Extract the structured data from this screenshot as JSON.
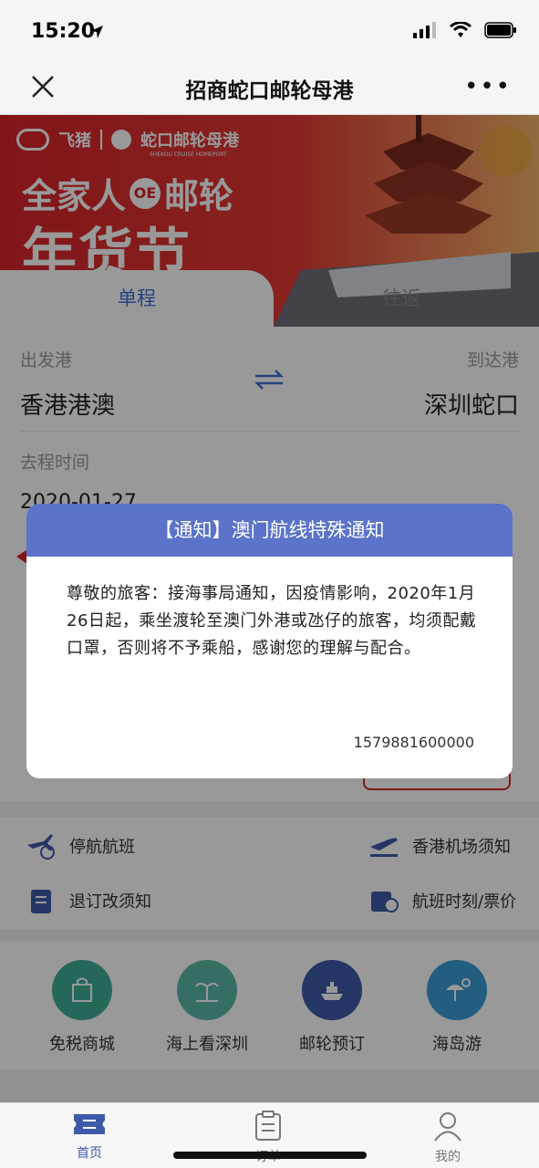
{
  "status": {
    "time": "15:20"
  },
  "nav": {
    "title": "招商蛇口邮轮母港",
    "more": "•••"
  },
  "banner": {
    "brand_left": "飞猪",
    "brand_right": "蛇口邮轮母港",
    "brand_sub": "SHEKOU CRUISE HOMEPORT",
    "headline1_a": "全家人",
    "headline1_badge": "OE",
    "headline1_b": "邮轮",
    "headline2": "年货节"
  },
  "trip": {
    "tab_one": "单程",
    "tab_two": "往返"
  },
  "form": {
    "depart_label": "出发港",
    "arrive_label": "到达港",
    "depart_value": "香港港澳",
    "arrive_value": "深圳蛇口",
    "date_label": "去程时间",
    "date_value": "2020-01-27"
  },
  "links": {
    "suspended": "停航航班",
    "hk_airport": "香港机场须知",
    "refund": "退订改须知",
    "timetable": "航班时刻/票价"
  },
  "services": [
    {
      "label": "免税商城",
      "color": "#3fae97"
    },
    {
      "label": "海上看深圳",
      "color": "#5bb8a6"
    },
    {
      "label": "邮轮预订",
      "color": "#3f5aa8"
    },
    {
      "label": "海岛游",
      "color": "#3b9bd6"
    }
  ],
  "modal": {
    "title": "【通知】澳门航线特殊通知",
    "body": "尊敬的旅客：接海事局通知，因疫情影响，2020年1月26日起，乘坐渡轮至澳门外港或氹仔的旅客，均须配戴口罩，否则将不予乘船，感谢您的理解与配合。",
    "timestamp": "1579881600000"
  },
  "tabbar": {
    "home": "首页",
    "orders": "订单",
    "mine": "我的"
  },
  "colors": {
    "accent": "#3c6fd6",
    "modal_header": "#5b73c8",
    "banner_red": "#d8242b"
  }
}
